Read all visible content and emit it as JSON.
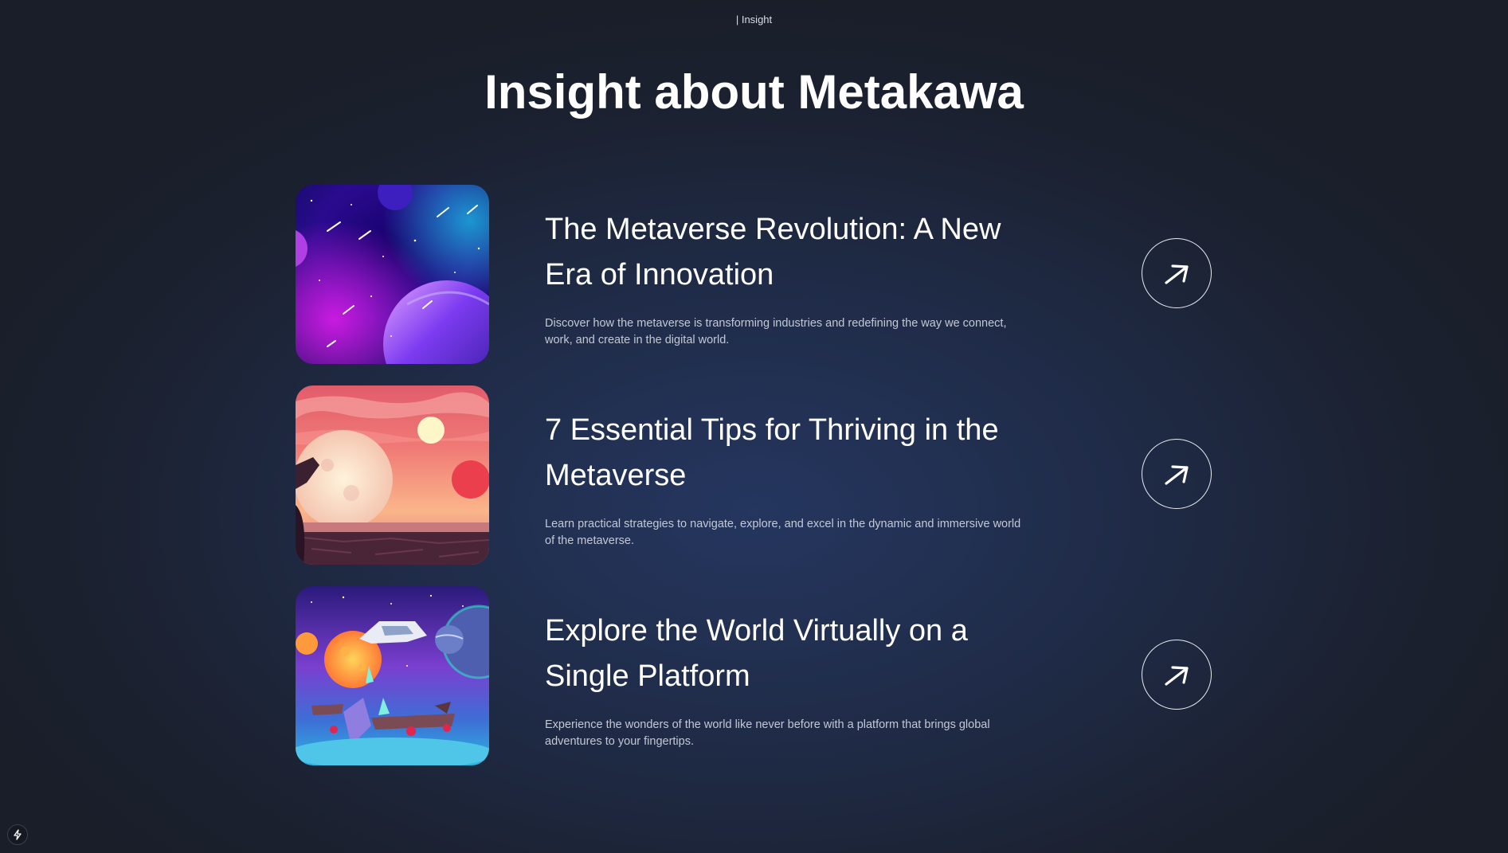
{
  "header": {
    "eyebrow": "| Insight",
    "title": "Insight about Metakawa"
  },
  "insights": [
    {
      "title": "The Metaverse Revolution: A New Era of Innovation",
      "description": "Discover how the metaverse is transforming industries and redefining the way we connect, work, and create in the digital world.",
      "image": "space-planets-illustration",
      "action_icon": "arrow-up-right-icon"
    },
    {
      "title": "7 Essential Tips for Thriving in the Metaverse",
      "description": "Learn practical strategies to navigate, explore, and excel in the dynamic and immersive world of the metaverse.",
      "image": "alien-sunset-landscape-illustration",
      "action_icon": "arrow-up-right-icon"
    },
    {
      "title": "Explore the World Virtually on a Single Platform",
      "description": "Experience the wonders of the world like never before with a platform that brings global adventures to your fingertips.",
      "image": "fantasy-spaceship-planets-illustration",
      "action_icon": "arrow-up-right-icon"
    }
  ],
  "corner_badge_icon": "lightning-bolt-icon",
  "colors": {
    "background": "#1b2130",
    "glow": "#25365f",
    "text": "#ffffff",
    "muted": "#c3c8d4"
  }
}
